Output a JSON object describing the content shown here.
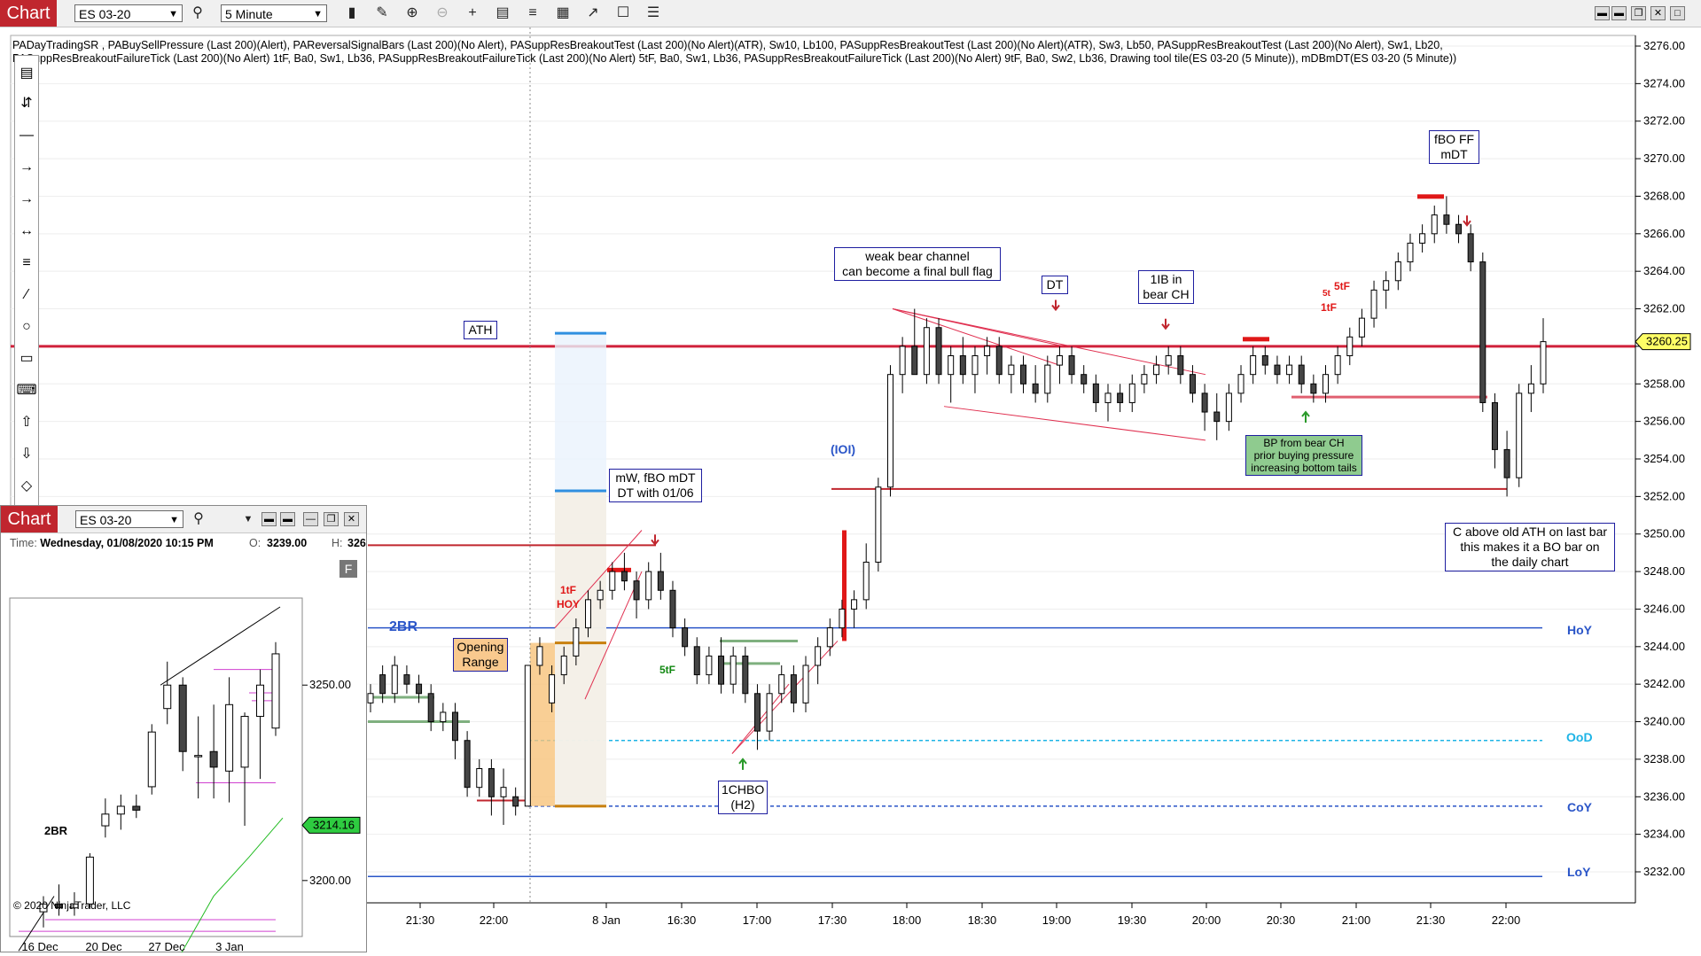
{
  "main_window": {
    "tab_label": "Chart",
    "instrument": "ES 03-20",
    "interval": "5 Minute",
    "indicators_text_line1": "PADayTradingSR , PABuySellPressure (Last 200)(Alert), PAReversalSignalBars (Last 200)(No Alert), PASuppResBreakoutTest (Last 200)(No Alert)(ATR),  Sw10,  Lb100, PASuppResBreakoutTest (Last 200)(No Alert)(ATR),  Sw3,  Lb50, PASuppResBreakoutTest (Last 200)(No Alert),  Sw1,  Lb20,",
    "indicators_text_line2": "PASuppResBreakoutFailureTick (Last 200)(No Alert) 1tF,  Ba0,  Sw1,  Lb36, PASuppResBreakoutFailureTick (Last 200)(No Alert) 5tF,  Ba0,  Sw1,  Lb36, PASuppResBreakoutFailureTick (Last 200)(No Alert) 9tF,  Ba0,  Sw2,  Lb36, Drawing tool tile(ES 03-20 (5 Minute)), mDBmDT(ES 03-20 (5 Minute))",
    "price_labels": [
      "3276.00",
      "3274.00",
      "3272.00",
      "3270.00",
      "3268.00",
      "3266.00",
      "3264.00",
      "3262.00",
      "3260.00",
      "3258.00",
      "3256.00",
      "3254.00",
      "3252.00",
      "3250.00",
      "3248.00",
      "3246.00",
      "3244.00",
      "3242.00",
      "3240.00",
      "3238.00",
      "3236.00",
      "3234.00",
      "3232.00"
    ],
    "time_labels": [
      "21:30",
      "22:00",
      "8 Jan",
      "16:30",
      "17:00",
      "17:30",
      "18:00",
      "18:30",
      "19:00",
      "19:30",
      "20:00",
      "20:30",
      "21:00",
      "21:30",
      "22:00"
    ],
    "current_price": "3260.25",
    "level_labels": {
      "hoy": "HoY",
      "ood": "OoD",
      "coy": "CoY",
      "loy": "LoY"
    },
    "annotations": {
      "ath": "ATH",
      "mw_line1": "mW, fBO mDT",
      "mw_line2": "DT with 01/06",
      "weak_line1": "weak bear channel",
      "weak_line2": "can become a final bull flag",
      "dt": "DT",
      "ib_line1": "1IB in",
      "ib_line2": "bear CH",
      "fbo_line1": "fBO FF",
      "fbo_line2": "mDT",
      "bp_line1": "BP from bear CH",
      "bp_line2": "prior buying pressure",
      "bp_line3": "increasing bottom tails",
      "c_line1": "C above old ATH on last bar",
      "c_line2": "this makes it a BO bar on",
      "c_line3": "the daily chart",
      "chbo_line1": "1CHBO",
      "chbo_line2": "(H2)",
      "opening_line1": "Opening",
      "opening_line2": "Range",
      "ioi": "(IOI)",
      "twobr": "2BR",
      "tf1": "1tF",
      "hoy_red": "HOY",
      "tf5_green": "5tF",
      "tf5_red": "5tF",
      "tf1_red2": "1tF",
      "tf5_partial": "5t"
    },
    "colors": {
      "tab_red": "#c0262e",
      "ath_line": "#d0213a",
      "blue_level": "#2a55c8",
      "cyan_level": "#1eb4e6",
      "bull_bar": "#ffffff",
      "bear_bar": "#454545"
    }
  },
  "sub_window": {
    "tab_label": "Chart",
    "instrument": "ES 03-20",
    "time_label": "Time:",
    "time_value": "Wednesday, 01/08/2020 10:15 PM",
    "open_label": "O:",
    "open_value": "3239.00",
    "high_label": "H:",
    "high_value": "326",
    "price_labels": [
      "3250.00",
      "3200.00"
    ],
    "current_price": "3214.16",
    "date_labels": [
      "16 Dec",
      "20 Dec",
      "27 Dec",
      "3 Jan"
    ],
    "twobr": "2BR",
    "copyright": "© 2020 NinjaTrader, LLC",
    "f_button": "F"
  },
  "chart_data": [
    {
      "type": "candlestick",
      "title": "ES 03-20 (5 Minute)",
      "ylim": [
        3231,
        3277
      ],
      "x_ticks": [
        "21:30",
        "22:00",
        "8 Jan",
        "16:30",
        "17:00",
        "17:30",
        "18:00",
        "18:30",
        "19:00",
        "19:30",
        "20:00",
        "20:30",
        "21:00",
        "21:30",
        "22:00"
      ],
      "levels": {
        "ATH": 3260.0,
        "HoY": 3245.0,
        "OoD": 3239.0,
        "CoY": 3235.5,
        "LoY": 3231.75
      },
      "last_price": 3260.25,
      "ohlc": [
        [
          3241.0,
          3242.0,
          3240.5,
          3241.5
        ],
        [
          3242.5,
          3243.0,
          3241.0,
          3241.5
        ],
        [
          3241.5,
          3243.5,
          3241.0,
          3243.0
        ],
        [
          3242.5,
          3243.0,
          3241.5,
          3242.0
        ],
        [
          3242.0,
          3242.5,
          3241.0,
          3241.5
        ],
        [
          3241.5,
          3242.0,
          3239.5,
          3240.0
        ],
        [
          3240.0,
          3241.0,
          3239.5,
          3240.5
        ],
        [
          3240.5,
          3241.0,
          3238.0,
          3239.0
        ],
        [
          3239.0,
          3239.5,
          3236.0,
          3236.5
        ],
        [
          3236.5,
          3238.0,
          3236.0,
          3237.5
        ],
        [
          3237.5,
          3238.0,
          3235.0,
          3236.0
        ],
        [
          3236.0,
          3237.5,
          3234.5,
          3236.5
        ],
        [
          3236.0,
          3236.5,
          3235.0,
          3235.5
        ],
        [
          3235.5,
          3243.0,
          3235.5,
          3243.0
        ],
        [
          3243.0,
          3244.5,
          3242.5,
          3244.0
        ],
        [
          3241.0,
          3243.0,
          3240.5,
          3242.5
        ],
        [
          3242.5,
          3244.0,
          3242.0,
          3243.5
        ],
        [
          3243.5,
          3245.5,
          3243.0,
          3245.0
        ],
        [
          3245.0,
          3247.0,
          3244.5,
          3246.5
        ],
        [
          3246.5,
          3247.5,
          3246.0,
          3247.0
        ],
        [
          3247.0,
          3248.5,
          3246.5,
          3248.0
        ],
        [
          3248.0,
          3249.0,
          3247.0,
          3247.5
        ],
        [
          3247.5,
          3248.0,
          3245.5,
          3246.5
        ],
        [
          3246.5,
          3248.5,
          3246.0,
          3248.0
        ],
        [
          3248.0,
          3249.0,
          3246.5,
          3247.0
        ],
        [
          3247.0,
          3247.5,
          3244.5,
          3245.0
        ],
        [
          3245.0,
          3245.5,
          3243.5,
          3244.0
        ],
        [
          3244.0,
          3244.5,
          3242.0,
          3242.5
        ],
        [
          3242.5,
          3244.0,
          3242.0,
          3243.5
        ],
        [
          3243.5,
          3244.5,
          3241.5,
          3242.0
        ],
        [
          3242.0,
          3244.0,
          3241.5,
          3243.5
        ],
        [
          3243.5,
          3244.0,
          3241.0,
          3241.5
        ],
        [
          3241.5,
          3242.0,
          3238.5,
          3239.5
        ],
        [
          3239.5,
          3242.0,
          3239.0,
          3241.5
        ],
        [
          3241.5,
          3243.0,
          3241.0,
          3242.5
        ],
        [
          3242.5,
          3243.0,
          3240.5,
          3241.0
        ],
        [
          3241.0,
          3243.5,
          3240.5,
          3243.0
        ],
        [
          3243.0,
          3244.5,
          3242.0,
          3244.0
        ],
        [
          3244.0,
          3245.5,
          3243.5,
          3245.0
        ],
        [
          3245.0,
          3246.5,
          3244.5,
          3246.0
        ],
        [
          3246.0,
          3247.0,
          3245.0,
          3246.5
        ],
        [
          3246.5,
          3249.5,
          3246.0,
          3248.5
        ],
        [
          3248.5,
          3253.0,
          3248.0,
          3252.5
        ],
        [
          3252.5,
          3259.0,
          3252.0,
          3258.5
        ],
        [
          3258.5,
          3260.5,
          3257.5,
          3260.0
        ],
        [
          3260.0,
          3262.0,
          3258.5,
          3258.5
        ],
        [
          3258.5,
          3261.5,
          3258.0,
          3261.0
        ],
        [
          3261.0,
          3261.5,
          3258.0,
          3258.5
        ],
        [
          3258.5,
          3260.0,
          3257.0,
          3259.5
        ],
        [
          3259.5,
          3260.5,
          3258.0,
          3258.5
        ],
        [
          3258.5,
          3260.0,
          3257.5,
          3259.5
        ],
        [
          3259.5,
          3260.5,
          3258.5,
          3260.0
        ],
        [
          3260.0,
          3260.5,
          3258.0,
          3258.5
        ],
        [
          3258.5,
          3259.5,
          3257.5,
          3259.0
        ],
        [
          3259.0,
          3259.5,
          3257.5,
          3258.0
        ],
        [
          3258.0,
          3259.0,
          3257.0,
          3257.5
        ],
        [
          3257.5,
          3259.5,
          3257.0,
          3259.0
        ],
        [
          3259.0,
          3260.0,
          3258.0,
          3259.5
        ],
        [
          3259.5,
          3260.0,
          3258.0,
          3258.5
        ],
        [
          3258.5,
          3259.0,
          3257.5,
          3258.0
        ],
        [
          3258.0,
          3258.5,
          3256.5,
          3257.0
        ],
        [
          3257.0,
          3258.0,
          3256.0,
          3257.5
        ],
        [
          3257.5,
          3258.0,
          3256.5,
          3257.0
        ],
        [
          3257.0,
          3258.5,
          3256.5,
          3258.0
        ],
        [
          3258.0,
          3259.0,
          3257.5,
          3258.5
        ],
        [
          3258.5,
          3259.5,
          3258.0,
          3259.0
        ],
        [
          3259.0,
          3260.0,
          3258.5,
          3259.5
        ],
        [
          3259.5,
          3260.0,
          3258.0,
          3258.5
        ],
        [
          3258.5,
          3259.0,
          3257.0,
          3257.5
        ],
        [
          3257.5,
          3258.0,
          3255.5,
          3256.5
        ],
        [
          3256.5,
          3257.5,
          3255.0,
          3256.0
        ],
        [
          3256.0,
          3258.0,
          3255.5,
          3257.5
        ],
        [
          3257.5,
          3259.0,
          3257.0,
          3258.5
        ],
        [
          3258.5,
          3260.0,
          3258.0,
          3259.5
        ],
        [
          3259.5,
          3260.0,
          3258.5,
          3259.0
        ],
        [
          3259.0,
          3259.5,
          3258.0,
          3258.5
        ],
        [
          3258.5,
          3259.5,
          3258.0,
          3259.0
        ],
        [
          3259.0,
          3259.5,
          3257.5,
          3258.0
        ],
        [
          3258.0,
          3258.5,
          3257.0,
          3257.5
        ],
        [
          3257.5,
          3259.0,
          3257.0,
          3258.5
        ],
        [
          3258.5,
          3260.0,
          3258.0,
          3259.5
        ],
        [
          3259.5,
          3261.0,
          3259.0,
          3260.5
        ],
        [
          3260.5,
          3262.0,
          3260.0,
          3261.5
        ],
        [
          3261.5,
          3263.5,
          3261.0,
          3263.0
        ],
        [
          3263.0,
          3264.0,
          3262.0,
          3263.5
        ],
        [
          3263.5,
          3265.0,
          3263.0,
          3264.5
        ],
        [
          3264.5,
          3266.0,
          3264.0,
          3265.5
        ],
        [
          3265.5,
          3266.5,
          3265.0,
          3266.0
        ],
        [
          3266.0,
          3267.5,
          3265.5,
          3267.0
        ],
        [
          3267.0,
          3268.0,
          3266.0,
          3266.5
        ],
        [
          3266.5,
          3267.0,
          3265.5,
          3266.0
        ],
        [
          3266.0,
          3266.5,
          3264.0,
          3264.5
        ],
        [
          3264.5,
          3265.0,
          3256.5,
          3257.0
        ],
        [
          3257.0,
          3257.5,
          3253.5,
          3254.5
        ],
        [
          3254.5,
          3255.5,
          3252.0,
          3253.0
        ],
        [
          3253.0,
          3258.0,
          3252.5,
          3257.5
        ],
        [
          3257.5,
          3259.0,
          3256.5,
          3258.0
        ],
        [
          3258.0,
          3261.5,
          3257.5,
          3260.25
        ]
      ]
    },
    {
      "type": "candlestick",
      "title": "ES 03-20 (Daily)",
      "ylim": [
        3185,
        3270
      ],
      "x_ticks": [
        "16 Dec",
        "20 Dec",
        "27 Dec",
        "3 Jan"
      ],
      "last_price": 3214.16,
      "ohlc": [
        [
          3192,
          3196,
          3188,
          3194
        ],
        [
          3194,
          3199,
          3191,
          3193
        ],
        [
          3193,
          3197,
          3191,
          3194
        ],
        [
          3194,
          3207,
          3193,
          3206
        ],
        [
          3214,
          3221,
          3211,
          3217
        ],
        [
          3217,
          3222,
          3213,
          3219
        ],
        [
          3219,
          3222,
          3216,
          3218
        ],
        [
          3224,
          3240,
          3222,
          3238
        ],
        [
          3244,
          3256,
          3240,
          3250
        ],
        [
          3250,
          3252,
          3228,
          3233
        ],
        [
          3232,
          3242,
          3221,
          3232
        ],
        [
          3233,
          3245,
          3221,
          3229
        ],
        [
          3228,
          3252,
          3220,
          3245
        ],
        [
          3229,
          3243,
          3214,
          3242
        ],
        [
          3242,
          3254,
          3226,
          3250
        ],
        [
          3239,
          3261,
          3237,
          3258
        ]
      ]
    }
  ]
}
